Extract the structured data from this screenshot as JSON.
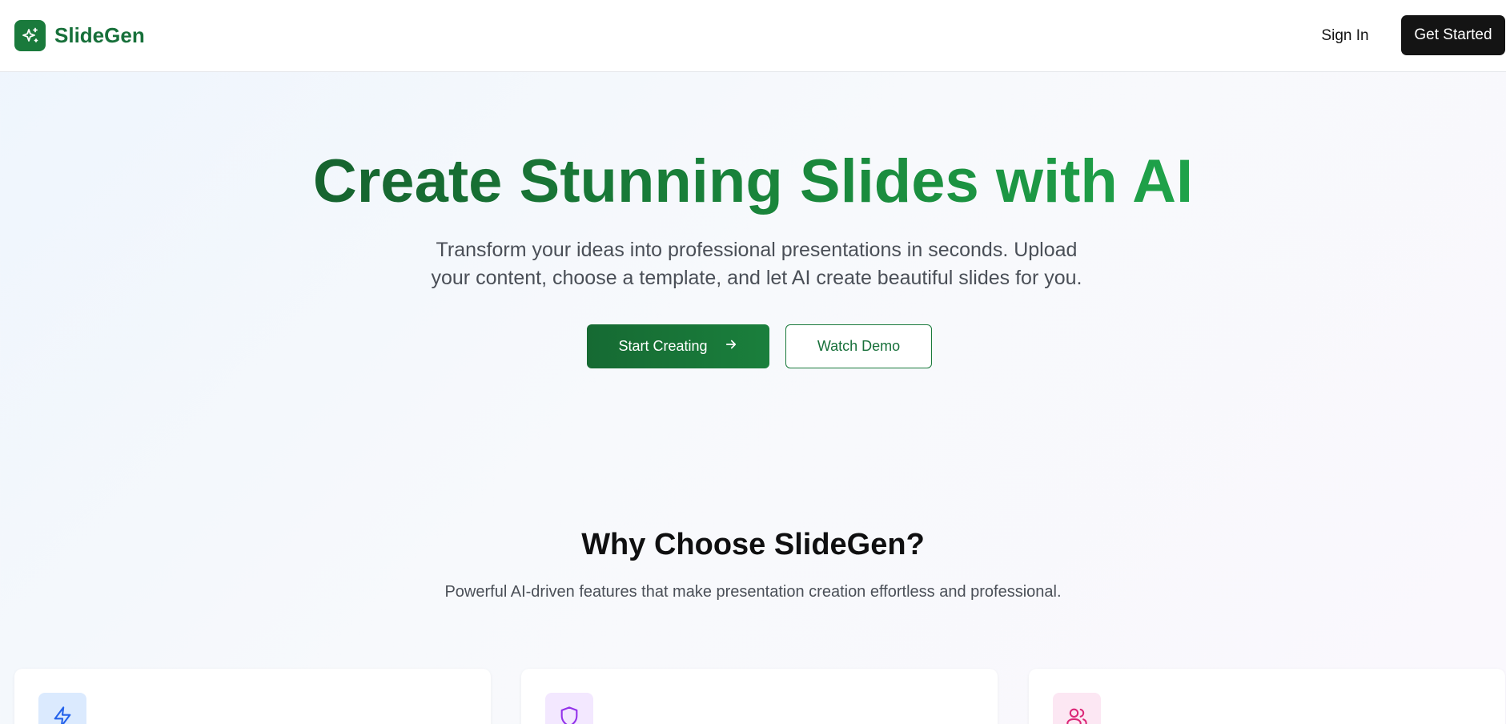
{
  "nav": {
    "brand": "SlideGen",
    "signin_label": "Sign In",
    "getstarted_label": "Get Started"
  },
  "hero": {
    "title": "Create Stunning Slides with AI",
    "subtitle": "Transform your ideas into professional presentations in seconds. Upload your content, choose a template, and let AI create beautiful slides for you.",
    "primary_label": "Start Creating",
    "secondary_label": "Watch Demo"
  },
  "features": {
    "title": "Why Choose SlideGen?",
    "subtitle": "Powerful AI-driven features that make presentation creation effortless and professional.",
    "cards": [
      {
        "icon": "lightning-icon",
        "bg": "#dbeafe",
        "color": "#2563eb"
      },
      {
        "icon": "shield-icon",
        "bg": "#f3e8ff",
        "color": "#9333ea"
      },
      {
        "icon": "users-icon",
        "bg": "#fce7f3",
        "color": "#db2777"
      }
    ]
  },
  "colors": {
    "brand_green": "#1a7a3c",
    "dark_button": "#141414"
  }
}
